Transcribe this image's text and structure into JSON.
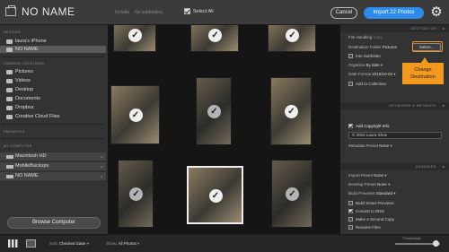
{
  "header": {
    "title": "NO NAME",
    "include_label": "Include",
    "subfolders_label": "No subfolders",
    "select_all_label": "Select All",
    "cancel_label": "Cancel",
    "import_label": "Import 22 Photos",
    "gear_icon": "gear-icon"
  },
  "sidebar": {
    "devices_header": "DEVICES",
    "devices": [
      {
        "label": "laura's iPhone",
        "icon": "phone-folder-icon"
      },
      {
        "label": "NO NAME",
        "icon": "card-folder-icon",
        "selected": true
      }
    ],
    "common_header": "COMMON LOCATIONS",
    "common": [
      {
        "label": "Pictures"
      },
      {
        "label": "Videos"
      },
      {
        "label": "Desktop"
      },
      {
        "label": "Documents"
      },
      {
        "label": "Dropbox"
      },
      {
        "label": "Creative Cloud Files"
      }
    ],
    "favorites_header": "FAVORITES",
    "computer_header": "MY COMPUTER",
    "drives": [
      {
        "label": "Macintosh HD"
      },
      {
        "label": "MobileBackups"
      },
      {
        "label": "NO NAME"
      }
    ],
    "browse_label": "Browse Computer"
  },
  "right_panel": {
    "destination_header": "DESTINATION",
    "file_handling_label": "File Handling",
    "file_handling_value": "Copy",
    "destination_folder_label": "Destination Folder",
    "destination_folder_value": "Pictures",
    "select_button": "Select...",
    "into_subfolder_label": "Into Subfolder",
    "organize_label": "Organize",
    "organize_value": "By date",
    "date_format_label": "Date Format",
    "date_format_value": "2015/10-03",
    "add_to_collection_label": "Add to Collection",
    "keywords_header": "KEYWORDS & METADATA",
    "add_copyright_label": "Add Copyright Info:",
    "copyright_value": "© 2015 Laura Shoe",
    "metadata_preset_label": "Metadata Preset",
    "metadata_preset_value": "None",
    "advanced_header": "ADVANCED",
    "import_preset_label": "Import Preset",
    "import_preset_value": "None",
    "develop_preset_label": "Develop Preset",
    "develop_preset_value": "None",
    "build_previews_label": "Build Previews",
    "build_previews_value": "Standard",
    "build_smart_label": "Build Smart Previews",
    "convert_dng_label": "Convert to DNG",
    "second_copy_label": "Make a Second Copy",
    "rename_label": "Rename Files"
  },
  "annotation": {
    "callout_text": "Change Destination",
    "accent_color": "#f39a1e"
  },
  "bottom_bar": {
    "sort_label": "Sort",
    "sort_value": "Checked State",
    "show_label": "Show",
    "show_value": "All Photos",
    "thumbnails_label": "Thumbnails"
  }
}
